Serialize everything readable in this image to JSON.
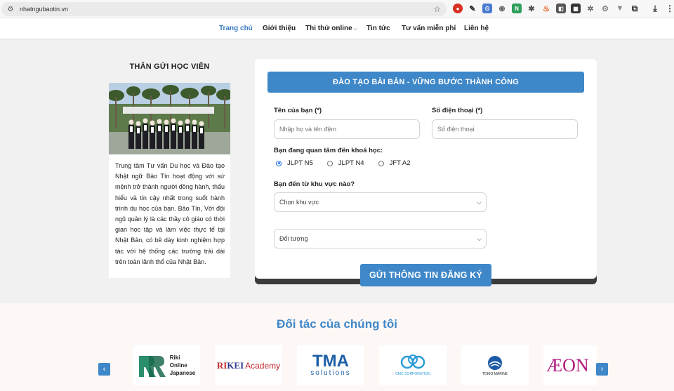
{
  "browser": {
    "url": "nhatngubaotin.vn"
  },
  "nav": {
    "items": [
      {
        "label": "Trang chủ"
      },
      {
        "label": "Giới thiệu"
      },
      {
        "label": "Thi thử online"
      },
      {
        "label": "Tin tức"
      },
      {
        "label": "Tư vấn miễn phí"
      },
      {
        "label": "Liên hệ"
      }
    ],
    "active_color": "#3a7bbf"
  },
  "left": {
    "title": "THÂN GỬI HỌC VIÊN",
    "text": "Trung tâm Tư vấn Du học và Đào tạo Nhật ngữ Bảo Tín hoạt động với sứ mệnh trở thành người đồng hành, thấu hiểu và tin cậy nhất trong suốt hành trình du học của bạn. Bảo Tín, Với đội ngũ quản lý là các thầy cô giáo có thời gian học tập và làm việc thực tế tại Nhật Bản, có bề dày kinh nghiệm hợp tác với hệ thống các trường trải dài trên toàn lãnh thổ của Nhật Bản."
  },
  "form": {
    "header": "ĐÀO TẠO BÀI BẢN - VỮNG BƯỚC THÀNH CÔNG",
    "name_label": "Tên của bạn (*)",
    "name_placeholder": "Nhập họ và tên đệm",
    "phone_label": "Số điện thoại (*)",
    "phone_placeholder": "Số điện thoại",
    "course_label": "Bạn đang quan tâm đến khoá học:",
    "courses": [
      {
        "label": "JLPT N5",
        "checked": true
      },
      {
        "label": "JLPT N4",
        "checked": false
      },
      {
        "label": "JFT A2",
        "checked": false
      }
    ],
    "region_label": "Bạn đến từ khu vực nào?",
    "region_selected": "Chọn khu vực",
    "audience_selected": "Đối tượng",
    "submit_label": "GỬI THÔNG TIN ĐĂNG KÝ"
  },
  "partners": {
    "title": "Đối tác của chúng tôi",
    "logos": [
      {
        "name": "Riki Online Japanese",
        "line1": "Riki",
        "line2": "Online",
        "line3": "Japanese"
      },
      {
        "name": "Riki Academy",
        "text": "Academy"
      },
      {
        "name": "TMA Solutions",
        "text_top": "TMA",
        "text_bottom": "solutions"
      },
      {
        "name": "CMC Corporation",
        "text": "CMC CORPORATION"
      },
      {
        "name": "Tokio Marine",
        "text": "TOKIO MARINE"
      },
      {
        "name": "AEON",
        "text": "ÆON"
      }
    ]
  },
  "colors": {
    "brand_blue": "#3e87c8",
    "form_shadow": "#3b3b3b",
    "partners_bg": "#fdf7f6"
  }
}
